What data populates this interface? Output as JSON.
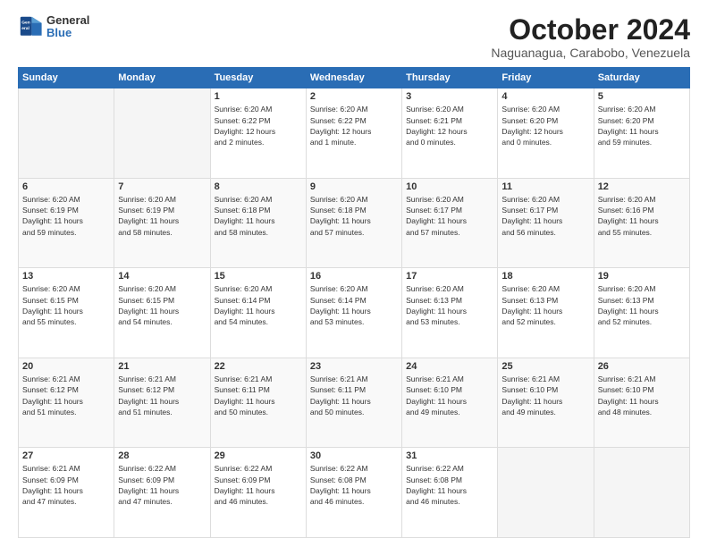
{
  "header": {
    "logo_general": "General",
    "logo_blue": "Blue",
    "month_title": "October 2024",
    "location": "Naguanagua, Carabobo, Venezuela"
  },
  "days_of_week": [
    "Sunday",
    "Monday",
    "Tuesday",
    "Wednesday",
    "Thursday",
    "Friday",
    "Saturday"
  ],
  "weeks": [
    [
      {
        "day": "",
        "info": ""
      },
      {
        "day": "",
        "info": ""
      },
      {
        "day": "1",
        "info": "Sunrise: 6:20 AM\nSunset: 6:22 PM\nDaylight: 12 hours\nand 2 minutes."
      },
      {
        "day": "2",
        "info": "Sunrise: 6:20 AM\nSunset: 6:22 PM\nDaylight: 12 hours\nand 1 minute."
      },
      {
        "day": "3",
        "info": "Sunrise: 6:20 AM\nSunset: 6:21 PM\nDaylight: 12 hours\nand 0 minutes."
      },
      {
        "day": "4",
        "info": "Sunrise: 6:20 AM\nSunset: 6:20 PM\nDaylight: 12 hours\nand 0 minutes."
      },
      {
        "day": "5",
        "info": "Sunrise: 6:20 AM\nSunset: 6:20 PM\nDaylight: 11 hours\nand 59 minutes."
      }
    ],
    [
      {
        "day": "6",
        "info": "Sunrise: 6:20 AM\nSunset: 6:19 PM\nDaylight: 11 hours\nand 59 minutes."
      },
      {
        "day": "7",
        "info": "Sunrise: 6:20 AM\nSunset: 6:19 PM\nDaylight: 11 hours\nand 58 minutes."
      },
      {
        "day": "8",
        "info": "Sunrise: 6:20 AM\nSunset: 6:18 PM\nDaylight: 11 hours\nand 58 minutes."
      },
      {
        "day": "9",
        "info": "Sunrise: 6:20 AM\nSunset: 6:18 PM\nDaylight: 11 hours\nand 57 minutes."
      },
      {
        "day": "10",
        "info": "Sunrise: 6:20 AM\nSunset: 6:17 PM\nDaylight: 11 hours\nand 57 minutes."
      },
      {
        "day": "11",
        "info": "Sunrise: 6:20 AM\nSunset: 6:17 PM\nDaylight: 11 hours\nand 56 minutes."
      },
      {
        "day": "12",
        "info": "Sunrise: 6:20 AM\nSunset: 6:16 PM\nDaylight: 11 hours\nand 55 minutes."
      }
    ],
    [
      {
        "day": "13",
        "info": "Sunrise: 6:20 AM\nSunset: 6:15 PM\nDaylight: 11 hours\nand 55 minutes."
      },
      {
        "day": "14",
        "info": "Sunrise: 6:20 AM\nSunset: 6:15 PM\nDaylight: 11 hours\nand 54 minutes."
      },
      {
        "day": "15",
        "info": "Sunrise: 6:20 AM\nSunset: 6:14 PM\nDaylight: 11 hours\nand 54 minutes."
      },
      {
        "day": "16",
        "info": "Sunrise: 6:20 AM\nSunset: 6:14 PM\nDaylight: 11 hours\nand 53 minutes."
      },
      {
        "day": "17",
        "info": "Sunrise: 6:20 AM\nSunset: 6:13 PM\nDaylight: 11 hours\nand 53 minutes."
      },
      {
        "day": "18",
        "info": "Sunrise: 6:20 AM\nSunset: 6:13 PM\nDaylight: 11 hours\nand 52 minutes."
      },
      {
        "day": "19",
        "info": "Sunrise: 6:20 AM\nSunset: 6:13 PM\nDaylight: 11 hours\nand 52 minutes."
      }
    ],
    [
      {
        "day": "20",
        "info": "Sunrise: 6:21 AM\nSunset: 6:12 PM\nDaylight: 11 hours\nand 51 minutes."
      },
      {
        "day": "21",
        "info": "Sunrise: 6:21 AM\nSunset: 6:12 PM\nDaylight: 11 hours\nand 51 minutes."
      },
      {
        "day": "22",
        "info": "Sunrise: 6:21 AM\nSunset: 6:11 PM\nDaylight: 11 hours\nand 50 minutes."
      },
      {
        "day": "23",
        "info": "Sunrise: 6:21 AM\nSunset: 6:11 PM\nDaylight: 11 hours\nand 50 minutes."
      },
      {
        "day": "24",
        "info": "Sunrise: 6:21 AM\nSunset: 6:10 PM\nDaylight: 11 hours\nand 49 minutes."
      },
      {
        "day": "25",
        "info": "Sunrise: 6:21 AM\nSunset: 6:10 PM\nDaylight: 11 hours\nand 49 minutes."
      },
      {
        "day": "26",
        "info": "Sunrise: 6:21 AM\nSunset: 6:10 PM\nDaylight: 11 hours\nand 48 minutes."
      }
    ],
    [
      {
        "day": "27",
        "info": "Sunrise: 6:21 AM\nSunset: 6:09 PM\nDaylight: 11 hours\nand 47 minutes."
      },
      {
        "day": "28",
        "info": "Sunrise: 6:22 AM\nSunset: 6:09 PM\nDaylight: 11 hours\nand 47 minutes."
      },
      {
        "day": "29",
        "info": "Sunrise: 6:22 AM\nSunset: 6:09 PM\nDaylight: 11 hours\nand 46 minutes."
      },
      {
        "day": "30",
        "info": "Sunrise: 6:22 AM\nSunset: 6:08 PM\nDaylight: 11 hours\nand 46 minutes."
      },
      {
        "day": "31",
        "info": "Sunrise: 6:22 AM\nSunset: 6:08 PM\nDaylight: 11 hours\nand 46 minutes."
      },
      {
        "day": "",
        "info": ""
      },
      {
        "day": "",
        "info": ""
      }
    ]
  ]
}
